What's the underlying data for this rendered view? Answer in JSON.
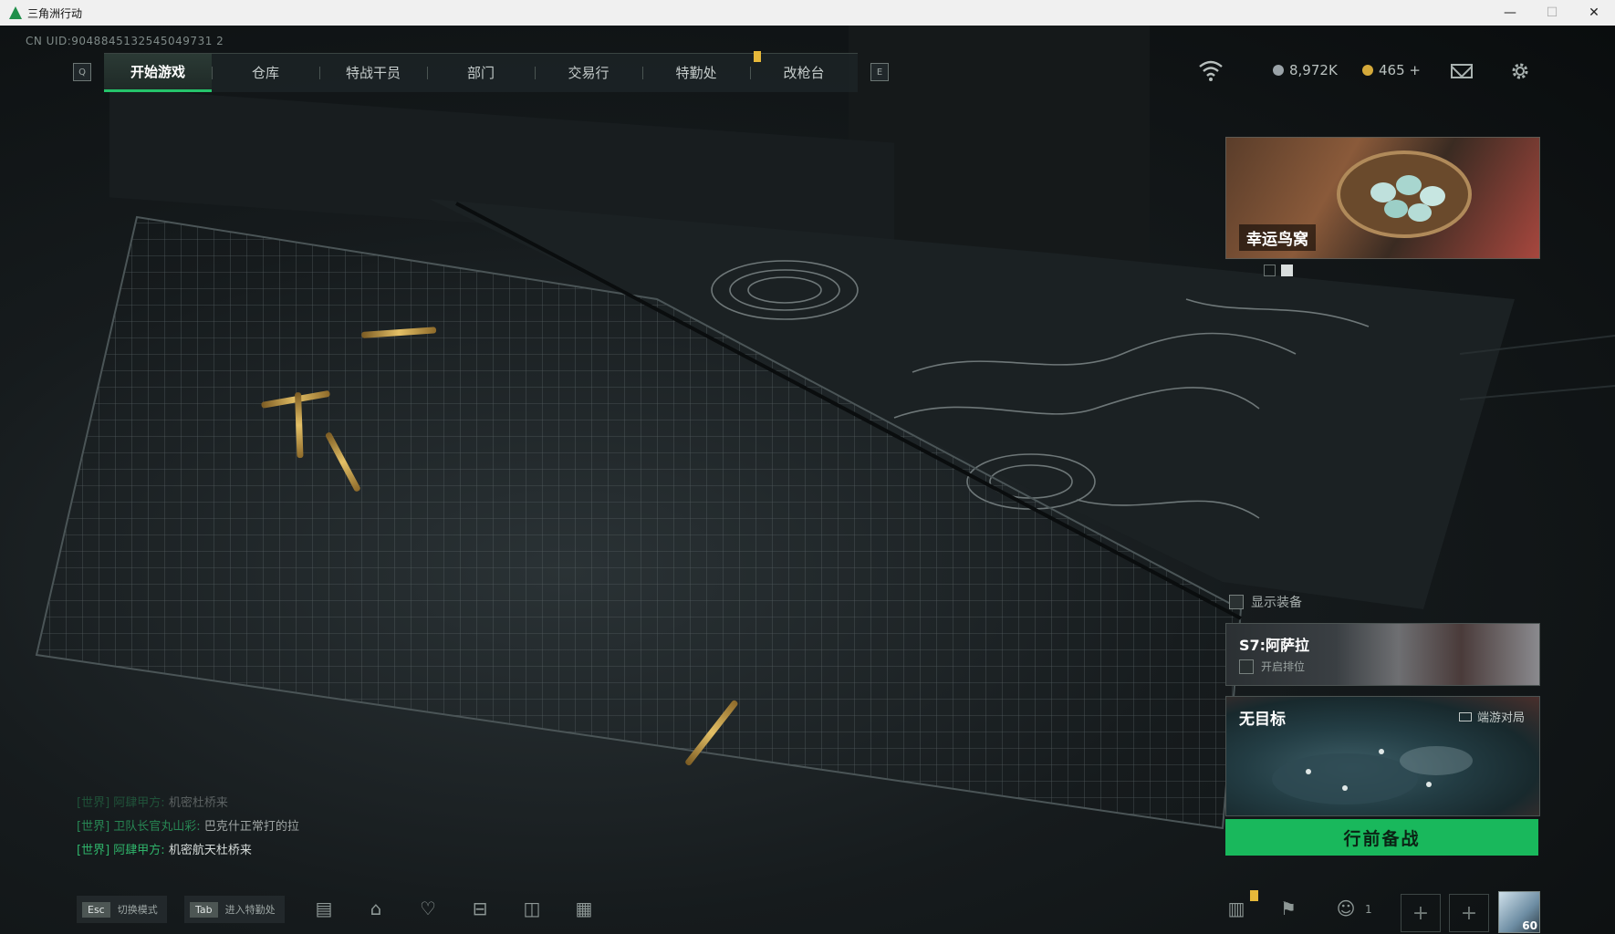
{
  "window": {
    "title": "三角洲行动",
    "buttons": [
      "—",
      "☐",
      "✕"
    ]
  },
  "uid": "CN UID:9048845132545049731 2",
  "nav": {
    "left_key": "Q",
    "right_key": "E",
    "tabs": [
      {
        "label": "开始游戏",
        "active": true
      },
      {
        "label": "仓库"
      },
      {
        "label": "特战干员"
      },
      {
        "label": "部门"
      },
      {
        "label": "交易行"
      },
      {
        "label": "特勤处"
      },
      {
        "label": "改枪台"
      }
    ]
  },
  "status": {
    "wifi_icon": "wifi-icon",
    "currency_1": "8,972K",
    "currency_2": "465 +",
    "currency_1_color": "#9aa3a8",
    "currency_2_color": "#d4a93a"
  },
  "event": {
    "title": "幸运鸟窝",
    "slides": 2,
    "active_slide": 1
  },
  "right_panel": {
    "show_equipment": "显示装备",
    "season_title": "S7:阿萨拉",
    "season_toggle": "开启排位",
    "map_title": "无目标",
    "map_mode": "端游对局",
    "deploy_button": "行前备战",
    "accent": "#19b85c"
  },
  "chat": [
    {
      "channel": "[世界]",
      "who": "阿肆甲方:",
      "msg": "机密杜桥来"
    },
    {
      "channel": "[世界]",
      "who": "卫队长官丸山彩:",
      "msg": "巴克什正常打的拉"
    },
    {
      "channel": "[世界]",
      "who": "阿肆甲方:",
      "msg": "机密航天杜桥来"
    }
  ],
  "bottom": {
    "esc_key": "Esc",
    "esc_label": "切换模式",
    "tab_key": "Tab",
    "tab_label": "进入特勤处",
    "party_count": "1",
    "avatar_level": "60",
    "icons": [
      "chat-icon",
      "gift-icon",
      "heart-shield-icon",
      "cart-icon",
      "battlepass-icon",
      "calendar-icon",
      "stats-icon",
      "flag-icon",
      "party-icon"
    ]
  }
}
